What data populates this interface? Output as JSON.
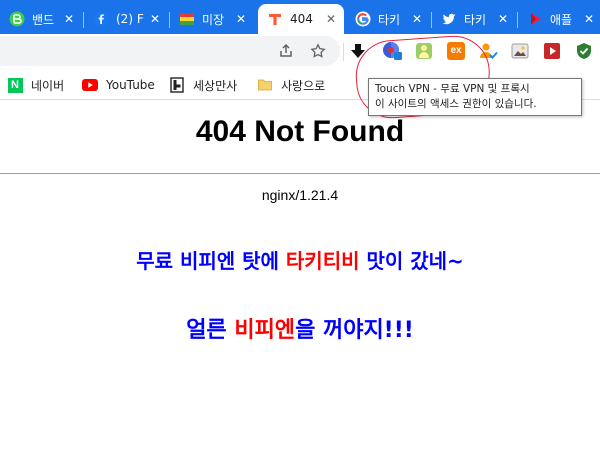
{
  "tabs": [
    {
      "title": "밴드",
      "icon": "band-icon",
      "active": false
    },
    {
      "title": "(2) F",
      "icon": "facebook-icon",
      "active": false
    },
    {
      "title": "미장",
      "icon": "flag-icon",
      "active": false
    },
    {
      "title": "404",
      "icon": "t-icon",
      "active": true
    },
    {
      "title": "타키",
      "icon": "google-icon",
      "active": false
    },
    {
      "title": "타키",
      "icon": "twitter-icon",
      "active": false
    },
    {
      "title": "애플",
      "icon": "play-icon",
      "active": false
    }
  ],
  "tab_close_glyph": "✕",
  "extensions": [
    "download-arrow-icon",
    "touch-vpn-icon",
    "green-person-icon",
    "ex-icon",
    "person-check-icon",
    "image-icon",
    "video-play-icon",
    "shield-check-icon"
  ],
  "bookmarks": [
    {
      "label": "네이버",
      "icon": "naver-icon"
    },
    {
      "label": "YouTube",
      "icon": "youtube-icon"
    },
    {
      "label": "세상만사",
      "icon": "tistory-icon"
    },
    {
      "label": "사랑으로",
      "icon": "folder-icon"
    }
  ],
  "ex_label": "ex",
  "naver_letter": "N",
  "tooltip": {
    "line1": "Touch VPN - 무료 VPN 및 프록시",
    "line2": "이 사이트의 액세스 권한이 있습니다."
  },
  "page": {
    "title": "404 Not Found",
    "server": "nginx/1.21.4",
    "message1_part1": "무료 비피엔 탓에 ",
    "message1_part2": "타키티비",
    "message1_part3": " 맛이 갔네~",
    "message2_part1": "얼른 ",
    "message2_part2": "비피엔",
    "message2_part3": "을 꺼야지!!!"
  },
  "colors": {
    "tabstrip": "#1a73e8",
    "message_blue": "#0000ff",
    "message_red": "#ff0000",
    "annotation_red": "#e8223a"
  }
}
